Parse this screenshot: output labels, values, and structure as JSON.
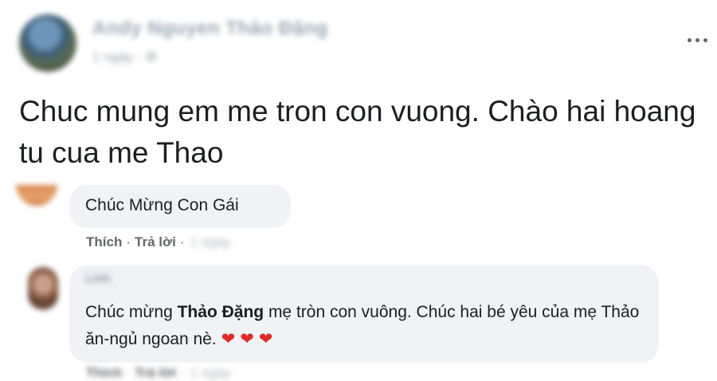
{
  "post": {
    "author": "Andy Nguyen Thảo Đặng",
    "time": "1 ngày · ⚙",
    "text": "Chuc mung em me tron con vuong. Chào hai hoang tu cua me Thao"
  },
  "comments": [
    {
      "text": "Chúc Mừng Con Gái",
      "like_label": "Thích",
      "reply_label": "Trả lời",
      "time": "1 ngày"
    },
    {
      "author": "Linh",
      "text_before": "Chúc mừng ",
      "mention": "Thảo Đặng",
      "text_after": " mẹ tròn con vuông. Chúc hai bé yêu của mẹ Thảo ăn-ngủ ngoan nè.",
      "hearts": "❤❤❤",
      "like_label": "Thích",
      "reply_label": "Trả lời",
      "time": "1 ngày"
    }
  ],
  "colors": {
    "bubble_bg": "#f0f2f5",
    "heart": "#e02b2b",
    "secondary_text": "#65676b"
  }
}
